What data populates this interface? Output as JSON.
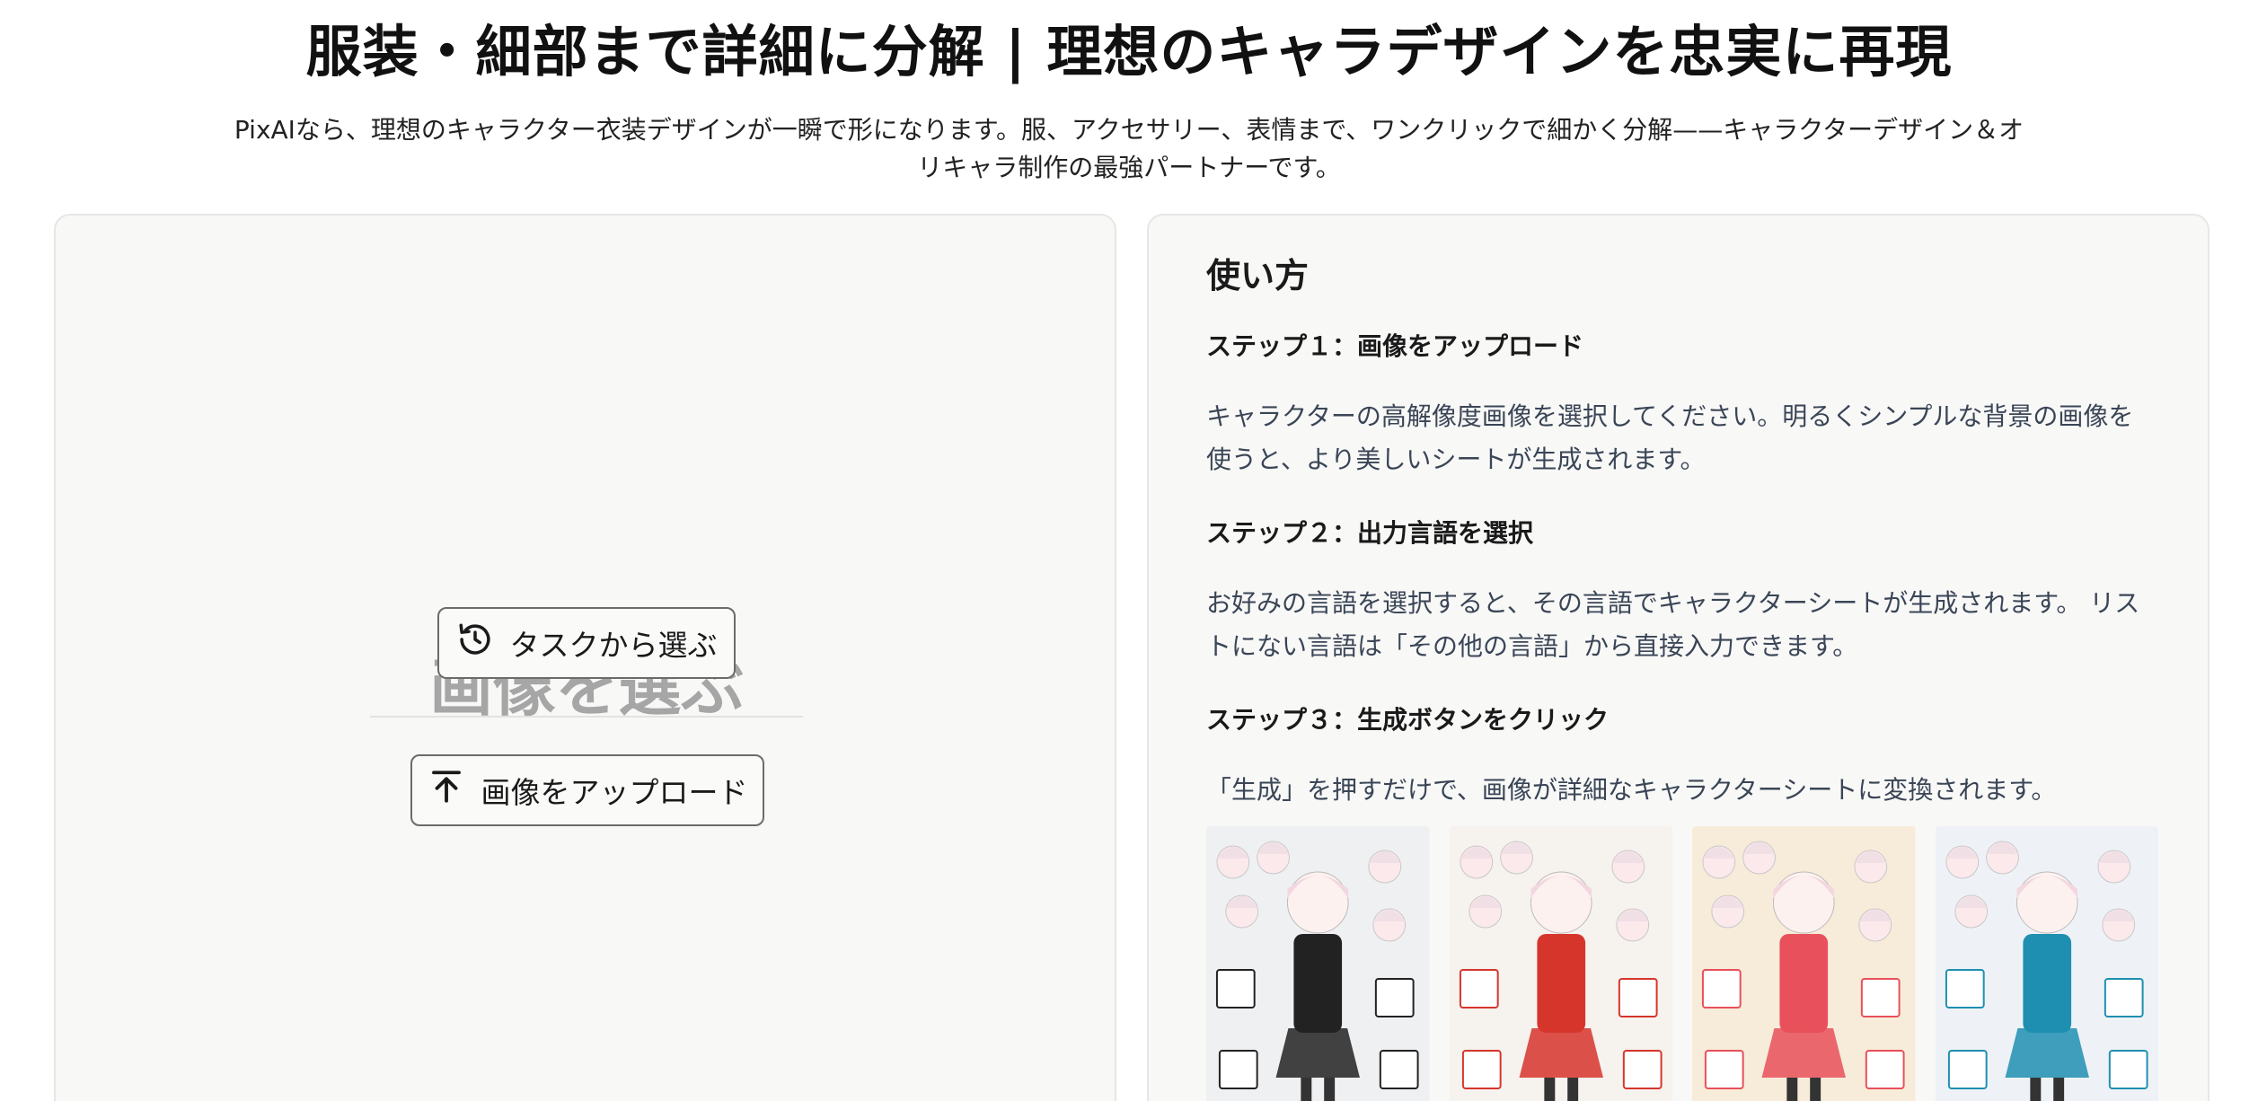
{
  "header": {
    "title": "服装・細部まで詳細に分解 | 理想のキャラデザインを忠実に再現",
    "subtitle": "PixAIなら、理想のキャラクター衣装デザインが一瞬で形になります。服、アクセサリー、表情まで、ワンクリックで細かく分解——キャラクターデザイン＆オリキャラ制作の最強パートナーです。"
  },
  "upload_panel": {
    "heading": "画像を選ぶ",
    "task_button_label": "タスクから選ぶ",
    "task_button_icon": "history-icon",
    "upload_button_label": "画像をアップロード",
    "upload_button_icon": "upload-arrow-icon"
  },
  "howto": {
    "title": "使い方",
    "steps": [
      {
        "heading": "ステップ１：画像をアップロード",
        "text": "キャラクターの高解像度画像を選択してください。明るくシンプルな背景の画像を使うと、より美しいシートが生成されます。"
      },
      {
        "heading": "ステップ２：出力言語を選択",
        "text": "お好みの言語を選択すると、その言語でキャラクターシートが生成されます。 リストにない言語は「その他の言語」から直接入力できます。"
      },
      {
        "heading": "ステップ３：生成ボタンをクリック",
        "text": "「生成」を押すだけで、画像が詳細なキャラクターシートに変換されます。"
      }
    ],
    "examples": [
      {
        "bg": "#eef0f2",
        "accent": "#222222"
      },
      {
        "bg": "#f6f2ee",
        "accent": "#d6352c"
      },
      {
        "bg": "#f7ecd9",
        "accent": "#e8505b"
      },
      {
        "bg": "#eef2f6",
        "accent": "#1e8fb0"
      }
    ]
  }
}
